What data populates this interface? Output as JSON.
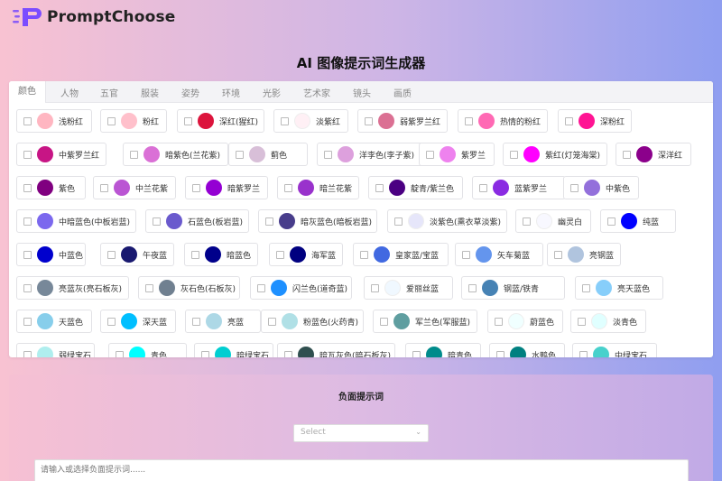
{
  "header": {
    "brand": "PromptChoose"
  },
  "page": {
    "title": "AI 图像提示词生成器"
  },
  "tabs": [
    {
      "label": "颜色",
      "active": true
    },
    {
      "label": "人物"
    },
    {
      "label": "五官"
    },
    {
      "label": "服装"
    },
    {
      "label": "姿势"
    },
    {
      "label": "环境"
    },
    {
      "label": "光影"
    },
    {
      "label": "艺术家"
    },
    {
      "label": "镜头"
    },
    {
      "label": "画质"
    }
  ],
  "colors": [
    {
      "label": "浅粉红",
      "color": "#ffb6c1"
    },
    {
      "label": "粉红",
      "color": "#ffc0cb"
    },
    {
      "label": "深红(猩红)",
      "color": "#dc143c"
    },
    {
      "label": "淡紫红",
      "color": "#fff0f5"
    },
    {
      "label": "弱紫罗兰红",
      "color": "#db7093"
    },
    {
      "label": "热情的粉红",
      "color": "#ff69b4"
    },
    {
      "label": "深粉红",
      "color": "#ff1493"
    },
    {
      "label": "中紫罗兰红",
      "color": "#c71585"
    },
    {
      "label": "暗紫色(兰花紫)",
      "color": "#da70d6"
    },
    {
      "label": "蓟色",
      "color": "#d8bfd8"
    },
    {
      "label": "洋李色(李子紫)",
      "color": "#dda0dd"
    },
    {
      "label": "紫罗兰",
      "color": "#ee82ee"
    },
    {
      "label": "紫红(灯笼海棠)",
      "color": "#ff00ff"
    },
    {
      "label": "深洋红",
      "color": "#8b008b"
    },
    {
      "label": "紫色",
      "color": "#800080"
    },
    {
      "label": "中兰花紫",
      "color": "#ba55d3"
    },
    {
      "label": "暗紫罗兰",
      "color": "#9400d3"
    },
    {
      "label": "暗兰花紫",
      "color": "#9932cc"
    },
    {
      "label": "靛青/紫兰色",
      "color": "#4b0082"
    },
    {
      "label": "蓝紫罗兰",
      "color": "#8a2be2"
    },
    {
      "label": "中紫色",
      "color": "#9370db"
    },
    {
      "label": "中暗蓝色(中板岩蓝)",
      "color": "#7b68ee"
    },
    {
      "label": "石蓝色(板岩蓝)",
      "color": "#6a5acd"
    },
    {
      "label": "暗灰蓝色(暗板岩蓝)",
      "color": "#483d8b"
    },
    {
      "label": "淡紫色(熏衣草淡紫)",
      "color": "#e6e6fa"
    },
    {
      "label": "幽灵白",
      "color": "#f8f8ff"
    },
    {
      "label": "纯蓝",
      "color": "#0000ff"
    },
    {
      "label": "中蓝色",
      "color": "#0000cd"
    },
    {
      "label": "午夜蓝",
      "color": "#191970"
    },
    {
      "label": "暗蓝色",
      "color": "#00008b"
    },
    {
      "label": "海军蓝",
      "color": "#000080"
    },
    {
      "label": "皇家蓝/宝蓝",
      "color": "#4169e1"
    },
    {
      "label": "矢车菊蓝",
      "color": "#6495ed"
    },
    {
      "label": "亮钢蓝",
      "color": "#b0c4de"
    },
    {
      "label": "亮蓝灰(亮石板灰)",
      "color": "#778899"
    },
    {
      "label": "灰石色(石板灰)",
      "color": "#708090"
    },
    {
      "label": "闪兰色(道奇蓝)",
      "color": "#1e90ff"
    },
    {
      "label": "爱丽丝蓝",
      "color": "#f0f8ff"
    },
    {
      "label": "钢蓝/铁青",
      "color": "#4682b4"
    },
    {
      "label": "亮天蓝色",
      "color": "#87cefa"
    },
    {
      "label": "天蓝色",
      "color": "#87ceeb"
    },
    {
      "label": "深天蓝",
      "color": "#00bfff"
    },
    {
      "label": "亮蓝",
      "color": "#add8e6"
    },
    {
      "label": "粉蓝色(火药青)",
      "color": "#b0e0e6"
    },
    {
      "label": "军兰色(军服蓝)",
      "color": "#5f9ea0"
    },
    {
      "label": "蔚蓝色",
      "color": "#f0ffff"
    },
    {
      "label": "淡青色",
      "color": "#e0ffff"
    },
    {
      "label": "弱绿宝石",
      "color": "#afeeee"
    },
    {
      "label": "青色",
      "color": "#00ffff"
    },
    {
      "label": "暗绿宝石",
      "color": "#00ced1"
    },
    {
      "label": "暗瓦灰色(暗石板灰)",
      "color": "#2f4f4f"
    },
    {
      "label": "暗青色",
      "color": "#008b8b"
    },
    {
      "label": "水鸭色",
      "color": "#008080"
    },
    {
      "label": "中绿宝石",
      "color": "#48d1cc"
    }
  ],
  "negative": {
    "title": "负面提示词",
    "select_placeholder": "Select",
    "textarea_placeholder": "请输入或选择负面提示词......"
  }
}
